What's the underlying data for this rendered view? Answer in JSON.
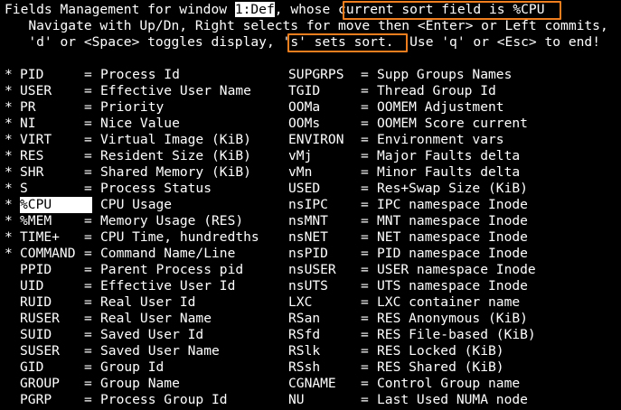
{
  "header": {
    "line1_a": "Fields Management for window ",
    "window_name": "1:Def",
    "line1_b": ", whose ",
    "sort_info": "current sort field is %CPU",
    "line2": "   Navigate with Up/Dn, Right selects for move then <Enter> or Left commits,",
    "line3_a": "   'd' or <Space> toggles display, ",
    "sort_hint": "'s' sets sort.",
    "line3_b": "  Use 'q' or <Esc> to end!"
  },
  "left_fields": [
    {
      "star": "*",
      "name": "PID",
      "eq": "=",
      "desc": "Process Id"
    },
    {
      "star": "*",
      "name": "USER",
      "eq": "=",
      "desc": "Effective User Name"
    },
    {
      "star": "*",
      "name": "PR",
      "eq": "=",
      "desc": "Priority"
    },
    {
      "star": "*",
      "name": "NI",
      "eq": "=",
      "desc": "Nice Value"
    },
    {
      "star": "*",
      "name": "VIRT",
      "eq": "=",
      "desc": "Virtual Image (KiB)"
    },
    {
      "star": "*",
      "name": "RES",
      "eq": "=",
      "desc": "Resident Size (KiB)"
    },
    {
      "star": "*",
      "name": "SHR",
      "eq": "=",
      "desc": "Shared Memory (KiB)"
    },
    {
      "star": "*",
      "name": "S",
      "eq": "=",
      "desc": "Process Status"
    },
    {
      "star": "*",
      "name": "%CPU",
      "eq": "=",
      "desc": "CPU Usage",
      "selected": true
    },
    {
      "star": "*",
      "name": "%MEM",
      "eq": "=",
      "desc": "Memory Usage (RES)"
    },
    {
      "star": "*",
      "name": "TIME+",
      "eq": "=",
      "desc": "CPU Time, hundredths"
    },
    {
      "star": "*",
      "name": "COMMAND",
      "eq": "=",
      "desc": "Command Name/Line"
    },
    {
      "star": "",
      "name": "PPID",
      "eq": "=",
      "desc": "Parent Process pid"
    },
    {
      "star": "",
      "name": "UID",
      "eq": "=",
      "desc": "Effective User Id"
    },
    {
      "star": "",
      "name": "RUID",
      "eq": "=",
      "desc": "Real User Id"
    },
    {
      "star": "",
      "name": "RUSER",
      "eq": "=",
      "desc": "Real User Name"
    },
    {
      "star": "",
      "name": "SUID",
      "eq": "=",
      "desc": "Saved User Id"
    },
    {
      "star": "",
      "name": "SUSER",
      "eq": "=",
      "desc": "Saved User Name"
    },
    {
      "star": "",
      "name": "GID",
      "eq": "=",
      "desc": "Group Id"
    },
    {
      "star": "",
      "name": "GROUP",
      "eq": "=",
      "desc": "Group Name"
    },
    {
      "star": "",
      "name": "PGRP",
      "eq": "=",
      "desc": "Process Group Id"
    }
  ],
  "right_fields": [
    {
      "name": "SUPGRPS",
      "eq": "=",
      "desc": "Supp Groups Names"
    },
    {
      "name": "TGID",
      "eq": "=",
      "desc": "Thread Group Id"
    },
    {
      "name": "OOMa",
      "eq": "=",
      "desc": "OOMEM Adjustment"
    },
    {
      "name": "OOMs",
      "eq": "=",
      "desc": "OOMEM Score current"
    },
    {
      "name": "ENVIRON",
      "eq": "=",
      "desc": "Environment vars"
    },
    {
      "name": "vMj",
      "eq": "=",
      "desc": "Major Faults delta"
    },
    {
      "name": "vMn",
      "eq": "=",
      "desc": "Minor Faults delta"
    },
    {
      "name": "USED",
      "eq": "=",
      "desc": "Res+Swap Size (KiB)"
    },
    {
      "name": "nsIPC",
      "eq": "=",
      "desc": "IPC namespace Inode"
    },
    {
      "name": "nsMNT",
      "eq": "=",
      "desc": "MNT namespace Inode"
    },
    {
      "name": "nsNET",
      "eq": "=",
      "desc": "NET namespace Inode"
    },
    {
      "name": "nsPID",
      "eq": "=",
      "desc": "PID namespace Inode"
    },
    {
      "name": "nsUSER",
      "eq": "=",
      "desc": "USER namespace Inode"
    },
    {
      "name": "nsUTS",
      "eq": "=",
      "desc": "UTS namespace Inode"
    },
    {
      "name": "LXC",
      "eq": "=",
      "desc": "LXC container name"
    },
    {
      "name": "RSan",
      "eq": "=",
      "desc": "RES Anonymous (KiB)"
    },
    {
      "name": "RSfd",
      "eq": "=",
      "desc": "RES File-based (KiB)"
    },
    {
      "name": "RSlk",
      "eq": "=",
      "desc": "RES Locked (KiB)"
    },
    {
      "name": "RSsh",
      "eq": "=",
      "desc": "RES Shared (KiB)"
    },
    {
      "name": "CGNAME",
      "eq": "=",
      "desc": "Control Group name"
    },
    {
      "name": "NU",
      "eq": "=",
      "desc": "Last Used NUMA node"
    }
  ],
  "colors": {
    "background": "#000000",
    "foreground": "#ffffff",
    "highlight": "#ffffff",
    "annotation_box": "#f07d1e"
  }
}
